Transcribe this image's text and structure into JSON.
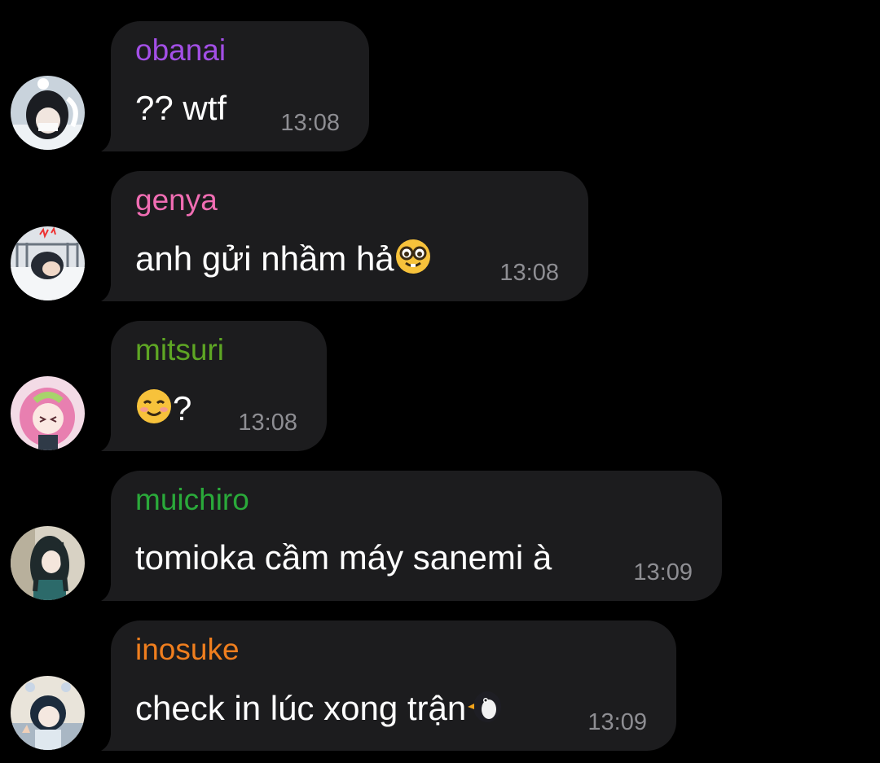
{
  "messages": [
    {
      "sender": "obanai",
      "sender_color": "#a34fe6",
      "text": "?? wtf",
      "time": "13:08",
      "avatar": "obanai-avatar",
      "emoji": ""
    },
    {
      "sender": "genya",
      "sender_color": "#f06db3",
      "text": "anh gửi nhầm hả",
      "time": "13:08",
      "avatar": "genya-avatar",
      "emoji": "nerd-face-emoji"
    },
    {
      "sender": "mitsuri",
      "sender_color": "#5ea624",
      "text": "?",
      "time": "13:08",
      "avatar": "mitsuri-avatar",
      "emoji": "smiling-face-emoji"
    },
    {
      "sender": "muichiro",
      "sender_color": "#2aa93a",
      "text": "tomioka cầm máy sanemi à",
      "time": "13:09",
      "avatar": "muichiro-avatar",
      "emoji": ""
    },
    {
      "sender": "inosuke",
      "sender_color": "#ef7e1e",
      "text": "check in lúc xong trận",
      "time": "13:09",
      "avatar": "inosuke-avatar",
      "emoji": "penguin-emoji"
    }
  ],
  "colors": {
    "background": "#000000",
    "bubble": "#1c1c1e",
    "message_text": "#ffffff",
    "timestamp": "#8e8e93"
  }
}
